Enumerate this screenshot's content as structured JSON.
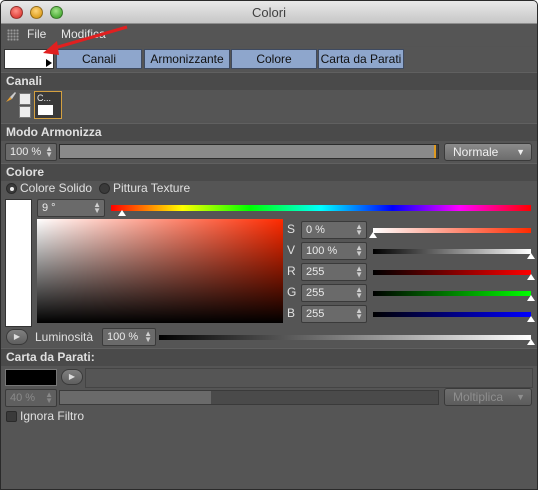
{
  "window": {
    "title": "Colori"
  },
  "menu": {
    "file": "File",
    "edit": "Modifica"
  },
  "tabs": [
    {
      "label": "Canali"
    },
    {
      "label": "Armonizzante"
    },
    {
      "label": "Colore"
    },
    {
      "label": "Carta da Parati"
    }
  ],
  "channels": {
    "title": "Canali",
    "item_label": "C..."
  },
  "harmony": {
    "title": "Modo Armonizza",
    "value": "100 %",
    "level": 1.0,
    "mode": "Normale"
  },
  "color": {
    "title": "Colore",
    "radio_solid": "Colore Solido",
    "radio_texture": "Pittura Texture",
    "hue_value": "9 °",
    "hue_level": 0.025,
    "channels": [
      {
        "label": "S",
        "value": "0 %",
        "level": 0.0
      },
      {
        "label": "V",
        "value": "100 %",
        "level": 1.0
      },
      {
        "label": "R",
        "value": "255",
        "level": 1.0
      },
      {
        "label": "G",
        "value": "255",
        "level": 1.0
      },
      {
        "label": "B",
        "value": "255",
        "level": 1.0
      }
    ],
    "brightness_label": "Luminosità",
    "brightness_value": "100 %",
    "brightness_level": 1.0,
    "current_color": "#ffffff",
    "hue_color": "#ff2a00"
  },
  "wallpaper": {
    "title": "Carta da Parati:",
    "swatch_color": "#000000",
    "percent": "40 %",
    "level": 0.4,
    "blend_mode": "Moltiplica",
    "ignore_filter": "Ignora Filtro"
  },
  "icons": {
    "grip": "grip-icon",
    "brush": "brush-icon",
    "play": "play-icon",
    "chevron": "chevron-down-icon",
    "spinner": "spinner-arrows-icon"
  }
}
